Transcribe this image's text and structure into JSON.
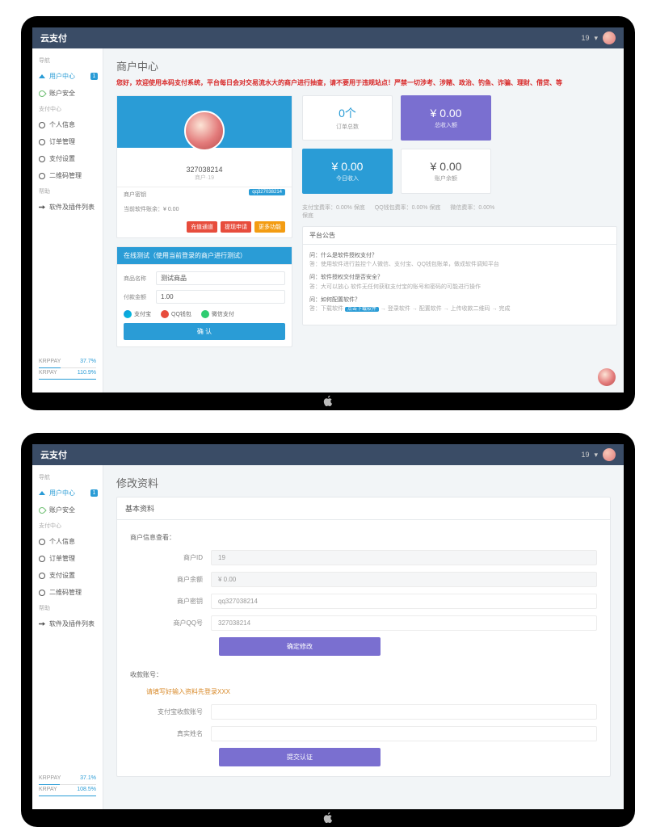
{
  "brand": "云支付",
  "user_badge": "19",
  "sidebar": {
    "group1": "导航",
    "items1": [
      {
        "label": "用户中心",
        "icon": "home-icon",
        "badge": "1",
        "active": true
      },
      {
        "label": "账户安全",
        "icon": "leaf-icon"
      }
    ],
    "group2": "支付中心",
    "items2": [
      {
        "label": "个人信息",
        "icon": "gear-icon"
      },
      {
        "label": "订单管理",
        "icon": "gear-icon"
      },
      {
        "label": "支付设置",
        "icon": "gear-icon"
      },
      {
        "label": "二维码管理",
        "icon": "gear-icon"
      }
    ],
    "group3": "帮助",
    "items3": [
      {
        "label": "软件及插件列表",
        "icon": "arrow-icon"
      }
    ],
    "stats1": [
      {
        "name": "KRPPAY",
        "value": "37.7%",
        "pct": 37.7
      },
      {
        "name": "KRPAY",
        "value": "110.9%",
        "pct": 100
      }
    ],
    "stats2": [
      {
        "name": "KRPPAY",
        "value": "37.1%",
        "pct": 37.1
      },
      {
        "name": "KRPAY",
        "value": "108.5%",
        "pct": 100
      }
    ]
  },
  "screen1": {
    "title": "商户中心",
    "notice": "您好，欢迎使用本码支付系统，平台每日会对交易流水大的商户进行抽查，请不要用于违规站点！严禁一切涉考、涉赌、政治、钓鱼、诈骗、理财、借贷、等",
    "profile": {
      "uid": "327038214",
      "sub": "商户·19",
      "key_label": "商户密钥",
      "key_tag": "qq327038214",
      "balance_label": "当前软件账余：¥ 0.00",
      "btn1": "充值通道",
      "btn2": "提现申请",
      "btn3": "更多功能"
    },
    "tiles": {
      "t1_big": "0个",
      "t1_small": "订单总数",
      "t2_big": "¥ 0.00",
      "t2_small": "总收入额",
      "t3_big": "¥ 0.00",
      "t3_small": "今日收入",
      "t4_big": "¥ 0.00",
      "t4_small": "账户余额"
    },
    "rates": {
      "r1": "支付宝费率：0.00% 保底",
      "r2": "QQ钱包费率：0.00% 保底",
      "r3": "微信费率：0.00% 保底"
    },
    "test": {
      "header": "在线测试（使用当前登录的商户进行测试）",
      "name_label": "商品名称",
      "name_value": "测试商品",
      "amount_label": "付款金额",
      "amount_value": "1.00",
      "pt1": "支付宝",
      "pt2": "QQ钱包",
      "pt3": "微信支付",
      "confirm": "确 认"
    },
    "faq": {
      "header": "平台公告",
      "q1": "问：什么是软件授权支付？",
      "a1": "答：使用软件进行监控个人微信、支付宝、QQ钱包账单，做成软件调知平台",
      "q2": "问：软件授权交付是否安全？",
      "a2": "答：大可以放心 软件无任何获取支付宝的账号和密码的可能进行操作",
      "q3": "问：如何配置软件？",
      "a3_pre": "答：下载软件 ",
      "a3_link": "点击下载软件",
      "a3_post": " → 登录软件 → 配置软件 → 上传收款二维码 → 完成"
    }
  },
  "screen2": {
    "title": "修改资料",
    "panel_header": "基本资料",
    "info_header": "商户信息查看：",
    "fields": {
      "id_label": "商户ID",
      "id_value": "19",
      "bal_label": "商户余额",
      "bal_value": "¥ 0.00",
      "key_label": "商户密钥",
      "key_value": "qq327038214",
      "qq_label": "商户QQ号",
      "qq_value": "327038214"
    },
    "btn_save": "确定修改",
    "recv_header": "收款账号：",
    "recv_warn": "请填写好输入资料先登录XXX",
    "ali_label": "支付宝收款账号",
    "ali_value": "",
    "name_label": "真实姓名",
    "name_value": "",
    "btn_submit": "提交认证"
  }
}
